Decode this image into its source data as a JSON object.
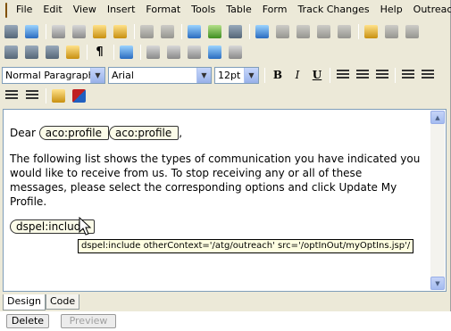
{
  "menu": {
    "items": [
      "File",
      "Edit",
      "View",
      "Insert",
      "Format",
      "Tools",
      "Table",
      "Form",
      "Track Changes",
      "Help",
      "Outreach"
    ]
  },
  "toolbar1_icons": [
    "print-icon",
    "spellcheck-icon",
    "cut-icon",
    "copy-icon",
    "paste-icon",
    "format-painter-icon",
    "undo-icon",
    "redo-icon",
    "web-link-icon",
    "image-icon",
    "equation-icon",
    "table-icon",
    "table-insert-row-icon",
    "table-insert-column-icon",
    "table-delete-column-icon",
    "table-delete-row-icon",
    "form-edit-icon",
    "form-icon",
    "form-icon"
  ],
  "toolbar2_icons": [
    "document-icon",
    "document-icon",
    "document-icon",
    "document-icon",
    "pilcrow-icon",
    "link-icon",
    "frame-icon",
    "frame-icon",
    "frame-icon",
    "frame-icon",
    "frame-icon"
  ],
  "format": {
    "paragraph_style": "Normal Paragraph",
    "font": "Arial",
    "size": "12pt",
    "bold": "B",
    "italic": "I",
    "underline": "U"
  },
  "document": {
    "greeting": "Dear",
    "tag1": "aco:profile",
    "tag2": "aco:profile",
    "comma": ",",
    "paragraph": "The following list shows the types of communication you have indicated you would like to receive from us. To stop receiving any or all of these messages, please select the corresponding options and click Update My Profile.",
    "include_tag": "dspel:include",
    "tooltip": "dspel:include otherContext='/atg/outreach' src='/optInOut/myOptIns.jsp'/"
  },
  "tabs": [
    "Design",
    "Code"
  ],
  "buttons": {
    "delete": "Delete",
    "preview": "Preview"
  }
}
